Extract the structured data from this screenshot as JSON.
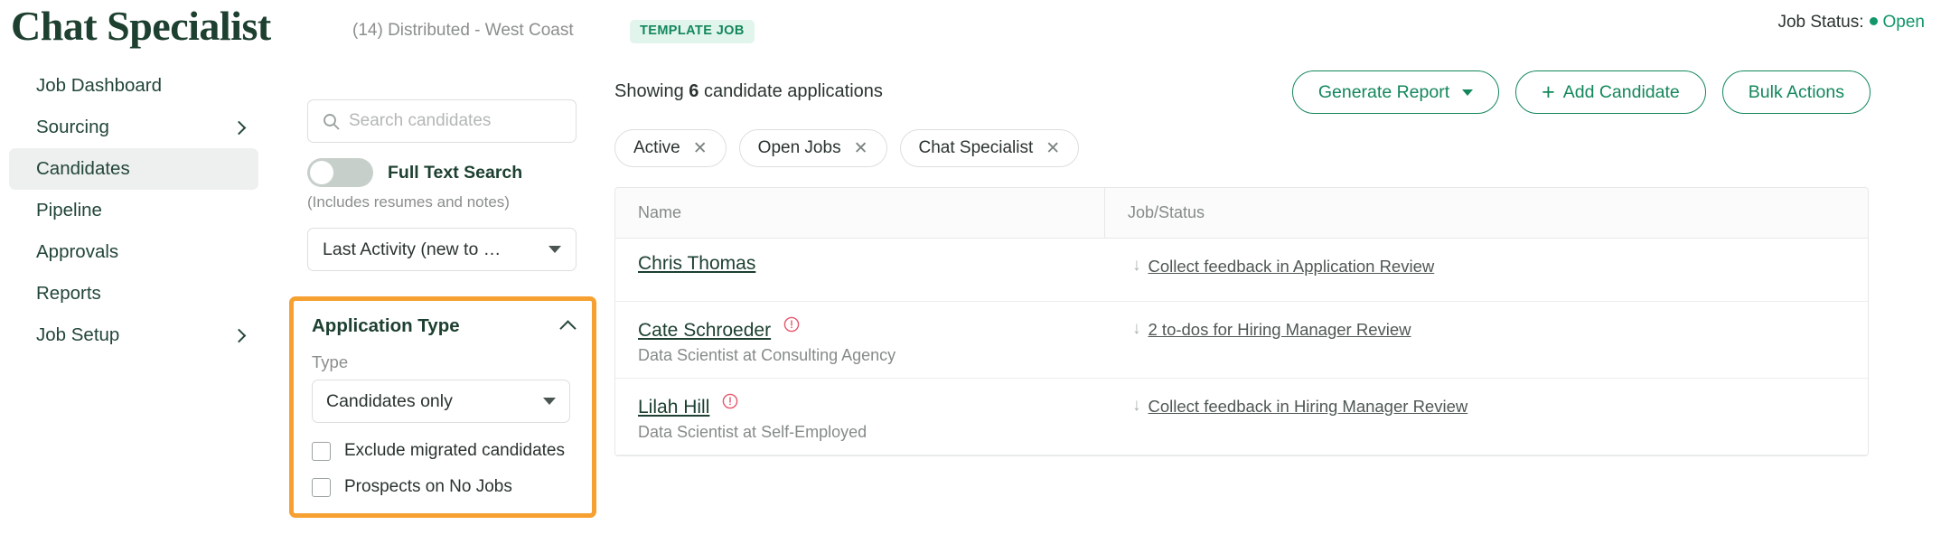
{
  "header": {
    "title": "Chat Specialist",
    "count": "(14)",
    "location": "Distributed - West Coast",
    "template_badge": "TEMPLATE JOB",
    "status_label": "Job Status:",
    "status_value": "Open",
    "status_color": "#12966a"
  },
  "sidebar": {
    "items": [
      {
        "label": "Job Dashboard",
        "expandable": false,
        "active": false
      },
      {
        "label": "Sourcing",
        "expandable": true,
        "active": false
      },
      {
        "label": "Candidates",
        "expandable": false,
        "active": true
      },
      {
        "label": "Pipeline",
        "expandable": false,
        "active": false
      },
      {
        "label": "Approvals",
        "expandable": false,
        "active": false
      },
      {
        "label": "Reports",
        "expandable": false,
        "active": false
      },
      {
        "label": "Job Setup",
        "expandable": true,
        "active": false
      }
    ]
  },
  "filters": {
    "search_placeholder": "Search candidates",
    "search_value": "",
    "search_icon": "search-icon",
    "fulltext_label": "Full Text Search",
    "fulltext_sub": "(Includes resumes and notes)",
    "fulltext_on": false,
    "sort_value": "Last Activity (new to …",
    "application_type": {
      "title": "Application Type",
      "collapse_icon": "chevron-up-icon",
      "type_label": "Type",
      "type_value": "Candidates only",
      "checkboxes": [
        {
          "label": "Exclude migrated candidates",
          "checked": false
        },
        {
          "label": "Prospects on No Jobs",
          "checked": false
        }
      ],
      "highlight_color": "#f7a032"
    }
  },
  "main": {
    "showing_prefix": "Showing ",
    "showing_count": "6",
    "showing_suffix": " candidate applications",
    "buttons": [
      {
        "label": "Generate Report",
        "caret": true,
        "plus": false
      },
      {
        "label": "Add Candidate",
        "caret": false,
        "plus": true
      },
      {
        "label": "Bulk Actions",
        "caret": false,
        "plus": false
      }
    ],
    "chips": [
      {
        "label": "Active"
      },
      {
        "label": "Open Jobs"
      },
      {
        "label": "Chat Specialist"
      }
    ],
    "table": {
      "columns": [
        "Name",
        "Job/Status"
      ],
      "rows": [
        {
          "name": "Chris Thomas",
          "alert": false,
          "subtitle": "",
          "status": "Collect feedback in Application Review"
        },
        {
          "name": "Cate Schroeder",
          "alert": true,
          "subtitle": "Data Scientist at Consulting Agency",
          "status": "2 to-dos for Hiring Manager Review"
        },
        {
          "name": "Lilah Hill",
          "alert": true,
          "subtitle": "Data Scientist at Self-Employed",
          "status": "Collect feedback in Hiring Manager Review"
        }
      ]
    }
  }
}
